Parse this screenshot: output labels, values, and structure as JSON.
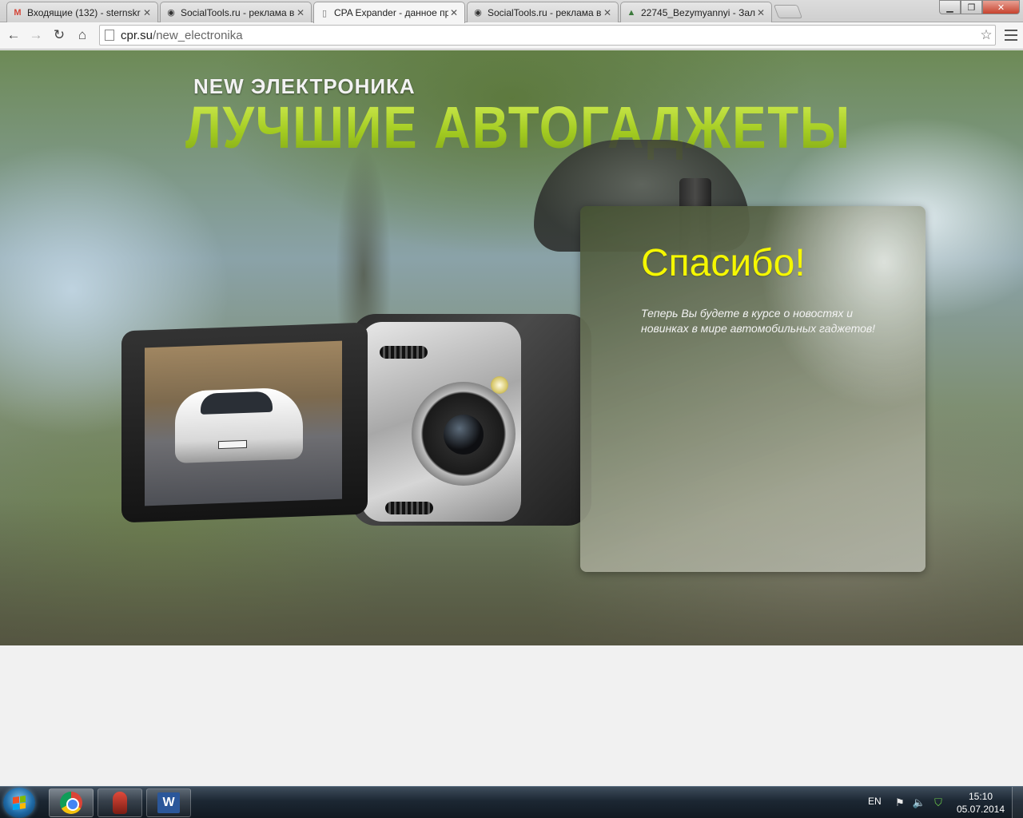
{
  "browser": {
    "tabs": [
      {
        "favicon": "gmail-icon",
        "title": "Входящие (132) - sternskr"
      },
      {
        "favicon": "socialtools-icon",
        "title": "SocialTools.ru - реклама в"
      },
      {
        "favicon": "page-icon",
        "title": "CPA Expander - данное пр",
        "active": true
      },
      {
        "favicon": "socialtools-icon",
        "title": "SocialTools.ru - реклама в"
      },
      {
        "favicon": "image-icon",
        "title": "22745_Bezymyannyi - Зал"
      }
    ],
    "url_host": "cpr.su",
    "url_path": "/new_electronika"
  },
  "page": {
    "brand_sub": "NEW ЭЛЕКТРОНИКА",
    "brand_title": "ЛУЧШИЕ АВТОГАДЖЕТЫ",
    "panel_title": "Спасибо!",
    "panel_text": "Теперь Вы будете в курсе о новостях и новинках в мире автомобильных гаджетов!",
    "colors": {
      "accent_green": "#a9d12a",
      "thanks_yellow": "#f5f700"
    }
  },
  "taskbar": {
    "apps": [
      "chrome-icon",
      "microphone-icon",
      "word-icon"
    ],
    "language": "EN",
    "time": "15:10",
    "date": "05.07.2014"
  }
}
